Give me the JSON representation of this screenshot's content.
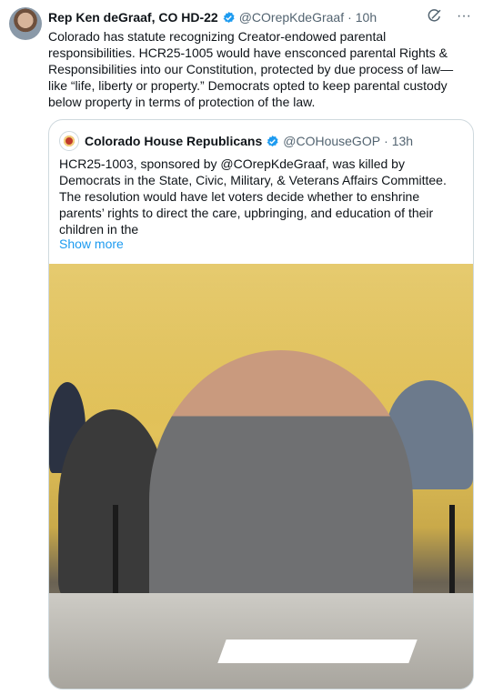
{
  "tweet": {
    "author_name": "Rep Ken deGraaf, CO HD-22",
    "handle": "@COrepKdeGraaf",
    "separator": "·",
    "time": "10h",
    "text": "Colorado has statute recognizing Creator-endowed parental responsibilities. HCR25-1005 would have ensconced parental Rights & Responsibilities into our Constitution, protected by due process of law—like “life, liberty or property.” Democrats opted to keep parental custody below property in terms of protection of the law.",
    "icons": [
      "grok-icon",
      "more-icon"
    ]
  },
  "quote": {
    "author_name": "Colorado House Republicans",
    "handle": "@COHouseGOP",
    "separator": "·",
    "time": "13h",
    "text": "HCR25-1003, sponsored by @COrepKdeGraaf, was killed by Democrats in the State, Civic, Military, & Veterans Affairs Committee. The resolution would have let voters decide whether to enshrine parents’ rights to direct the care, upbringing, and education of their children in the",
    "show_more": "Show more"
  },
  "colors": {
    "text": "#0f1419",
    "secondary": "#536471",
    "link": "#1d9bf0",
    "border": "#cfd9de",
    "verified": "#1d9bf0"
  }
}
